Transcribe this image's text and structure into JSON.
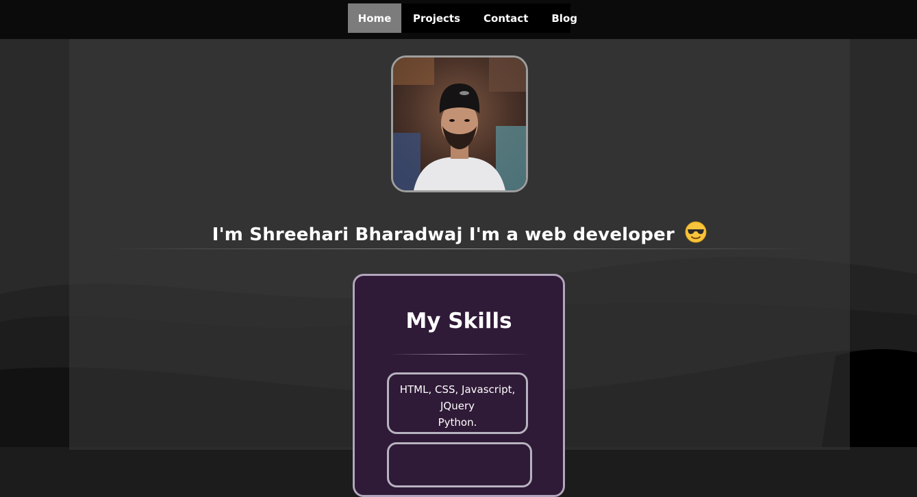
{
  "nav": {
    "items": [
      {
        "label": "Home",
        "active": true
      },
      {
        "label": "Projects",
        "active": false
      },
      {
        "label": "Contact",
        "active": false
      },
      {
        "label": "Blog",
        "active": false
      }
    ]
  },
  "hero": {
    "headline": "I'm Shreehari Bharadwaj I'm a web developer",
    "emoji_icon": "smiling-face-with-sunglasses"
  },
  "skills": {
    "title": "My Skills",
    "items": [
      {
        "lines": [
          "HTML, CSS, Javascript,",
          "JQuery",
          "Python."
        ]
      }
    ]
  },
  "colors": {
    "page_bg": "#1c1c1c",
    "navbar_bg": "#0b0b0b",
    "nav_active_bg": "#7c7c7c",
    "skills_card_bg": "#2f1a37",
    "card_border": "#b3a6bd"
  }
}
